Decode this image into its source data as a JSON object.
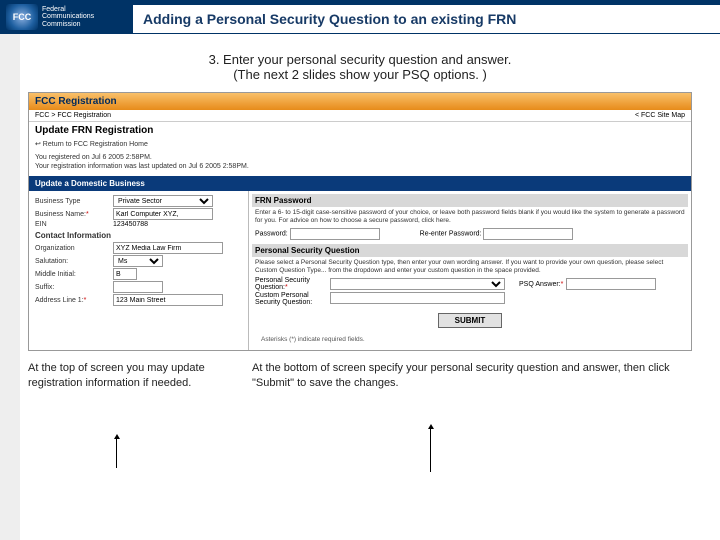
{
  "header": {
    "logo_text": "Federal\nCommunications\nCommission",
    "logo_mark": "FCC",
    "title": "Adding a Personal Security Question to an existing FRN"
  },
  "instructions": {
    "main": "3. Enter your personal security question and answer.",
    "sub": "(The next 2 slides show your PSQ options. )"
  },
  "form": {
    "reg_header": "FCC Registration",
    "crumbs_left": "FCC > FCC Registration",
    "crumbs_right": "< FCC Site Map",
    "sub_header": "Update FRN Registration",
    "back_link": "↩ Return to FCC Registration Home",
    "meta1": "You registered on Jul 6 2005 2:58PM.",
    "meta2": "Your registration information was last updated on Jul 6 2005 2:58PM.",
    "section_bar": "Update a Domestic Business",
    "left": {
      "business_type_label": "Business Type",
      "business_type_value": "Private Sector",
      "business_name_label": "Business Name:",
      "business_name_value": "Karl Computer XYZ,",
      "ein_label": "EIN",
      "ein_value": "123450788",
      "contact_section": "Contact Information",
      "org_label": "Organization",
      "org_value": "XYZ Media Law Firm",
      "salutation_label": "Salutation:",
      "salutation_value": "Ms",
      "middle_label": "Middle Initial:",
      "middle_value": "B",
      "suffix_label": "Suffix:",
      "suffix_value": "",
      "address_label": "Address Line 1:",
      "address_value": "123 Main Street"
    },
    "right": {
      "pwd_header": "FRN Password",
      "pwd_desc": "Enter a 6- to 15-digit case-sensitive password of your choice, or leave both password fields blank if you would like the system to generate a password for you. For advice on how to choose a secure password, click here.",
      "pwd_label": "Password:",
      "pwd2_label": "Re-enter Password:",
      "psq_header": "Personal Security Question",
      "psq_desc": "Please select a Personal Security Question type, then enter your own wording answer. If you want to provide your own question, please select Custom Question Type... from the dropdown and enter your custom question in the space provided.",
      "psq_label": "Personal Security Question:",
      "psq_answer_label": "PSQ Answer:",
      "custom_label": "Custom Personal Security Question:",
      "submit": "SUBMIT",
      "footnote": "Asterisks (*) indicate required fields."
    }
  },
  "captions": {
    "left": "At the top of screen you may update registration information if needed.",
    "right": "At the bottom of screen specify your personal security question and answer, then click \"Submit\" to save the changes."
  }
}
